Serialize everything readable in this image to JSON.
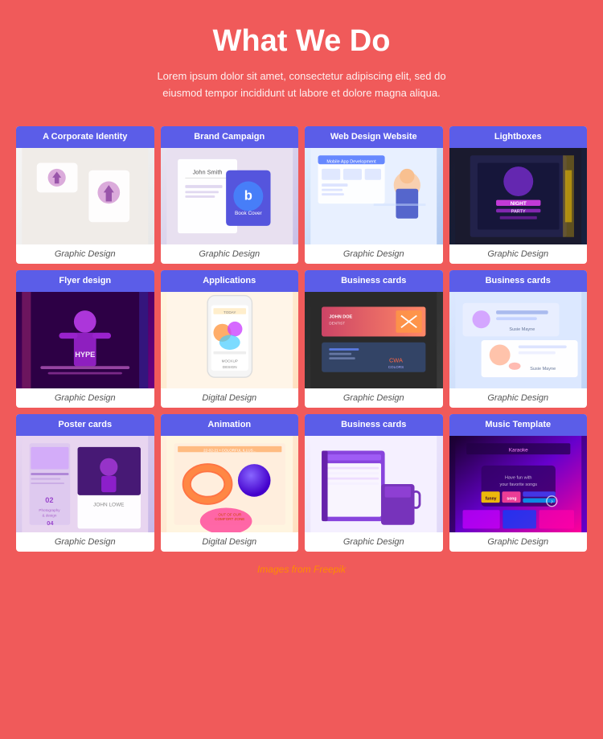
{
  "header": {
    "title": "What We Do",
    "description": "Lorem ipsum dolor sit amet, consectetur adipiscing elit, sed do eiusmod tempor incididunt ut labore et dolore magna aliqua."
  },
  "grid": {
    "cards": [
      {
        "id": "corporate-identity",
        "header": "A Corporate Identity",
        "footer": "Graphic Design",
        "img_class": "img-corporate"
      },
      {
        "id": "brand-campaign",
        "header": "Brand Campaign",
        "footer": "Graphic Design",
        "img_class": "img-brand"
      },
      {
        "id": "web-design",
        "header": "Web Design Website",
        "footer": "Graphic Design",
        "img_class": "img-webdesign"
      },
      {
        "id": "lightboxes",
        "header": "Lightboxes",
        "footer": "Graphic Design",
        "img_class": "img-lightbox"
      },
      {
        "id": "flyer-design",
        "header": "Flyer design",
        "footer": "Graphic Design",
        "img_class": "img-flyer"
      },
      {
        "id": "applications",
        "header": "Applications",
        "footer": "Digital Design",
        "img_class": "img-apps"
      },
      {
        "id": "business-cards-1",
        "header": "Business cards",
        "footer": "Graphic Design",
        "img_class": "img-bizcards1"
      },
      {
        "id": "business-cards-2",
        "header": "Business cards",
        "footer": "Graphic Design",
        "img_class": "img-bizcards2"
      },
      {
        "id": "poster-cards",
        "header": "Poster cards",
        "footer": "Graphic Design",
        "img_class": "img-poster"
      },
      {
        "id": "animation",
        "header": "Animation",
        "footer": "Digital Design",
        "img_class": "img-animation"
      },
      {
        "id": "business-cards-3",
        "header": "Business cards",
        "footer": "Graphic Design",
        "img_class": "img-bizcards3"
      },
      {
        "id": "music-template",
        "header": "Music Template",
        "footer": "Graphic Design",
        "img_class": "img-music"
      }
    ]
  },
  "footer": {
    "text": "Images from ",
    "link": "Freepik"
  }
}
